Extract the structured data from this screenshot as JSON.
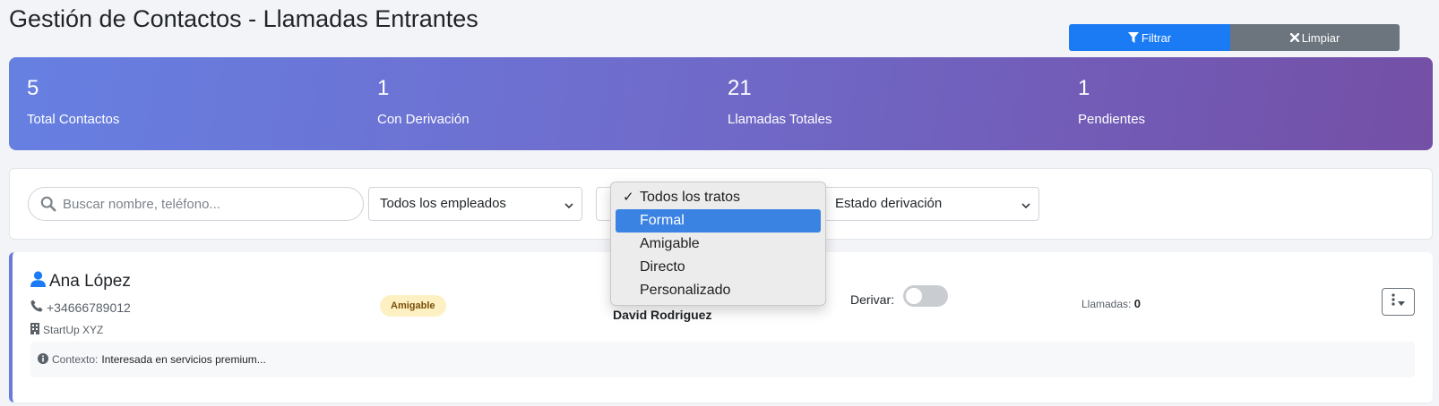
{
  "page": {
    "title": "Gestión de Contactos - Llamadas Entrantes"
  },
  "stats": [
    {
      "value": "5",
      "label": "Total Contactos"
    },
    {
      "value": "1",
      "label": "Con Derivación"
    },
    {
      "value": "21",
      "label": "Llamadas Totales"
    },
    {
      "value": "1",
      "label": "Pendientes"
    }
  ],
  "filters": {
    "search_placeholder": "Buscar nombre, teléfono...",
    "search_value": "",
    "employee_select": "Todos los empleados",
    "treatment_select": "Todos los tratos",
    "derivation_select": "Estado derivación",
    "filter_button": "Filtrar",
    "clear_button": "Limpiar"
  },
  "treatment_dropdown": {
    "options": [
      "Todos los tratos",
      "Formal",
      "Amigable",
      "Directo",
      "Personalizado"
    ],
    "selected": "Todos los tratos",
    "highlighted": "Formal"
  },
  "contact": {
    "name": "Ana López",
    "phone": "+34666789012",
    "company": "StartUp XYZ",
    "treatment_badge": "Amigable",
    "employee": "David Rodriguez",
    "derive_label": "Derivar:",
    "derive_on": false,
    "calls_label": "Llamadas:",
    "calls_value": "0",
    "context_label": "Contexto:",
    "context_value": "Interesada en servicios premium..."
  },
  "colors": {
    "primary": "#1a7bf5",
    "secondary": "#6c757d",
    "gradient_start": "#6680e2",
    "gradient_end": "#744fa6",
    "badge_bg": "#fdf1c4",
    "dropdown_highlight": "#3a83e3"
  },
  "icons": {
    "search": "search-icon",
    "filter": "filter-icon",
    "clear": "times-icon",
    "user": "user-icon",
    "phone": "phone-icon",
    "company": "building-icon",
    "info": "info-circle-icon",
    "actions": "ellipsis-vertical-icon"
  }
}
